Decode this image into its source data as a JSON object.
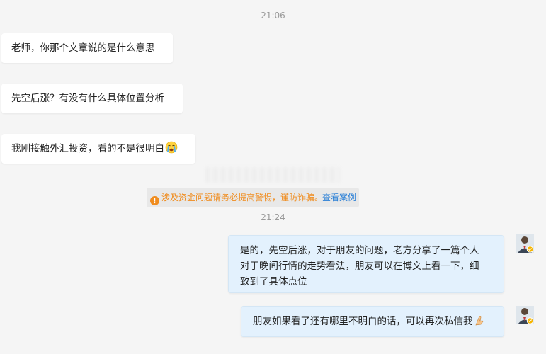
{
  "chat": {
    "time_1": "21:06",
    "time_2": "21:24",
    "incoming": [
      "老师，你那个文章说的是什么意思",
      "先空后涨？有没有什么具体位置分析",
      "我刚接触外汇投资，看的不是很明白"
    ],
    "outgoing": [
      {
        "lines": [
          "是的，先空后涨，对于朋友的问题，老方分享了一篇个人",
          "对于晚间行情的走势看法，朋友可以在博文上看一下，细",
          "致到了具体点位"
        ]
      },
      {
        "lines": [
          "朋友如果看了还有哪里不明白的话，可以再次私信我"
        ]
      }
    ],
    "emojis": [
      "crying-face-emoji",
      "folded-hands-emoji"
    ]
  },
  "warning": {
    "text": "涉及资金问题请务必提高警惕，谨防诈骗。",
    "link": "查看案例",
    "icon": "info-icon",
    "text_color": "#f08c1e",
    "link_color": "#2a7fd6"
  },
  "colors": {
    "background": "#f5f5f5",
    "incoming_bubble": "#ffffff",
    "outgoing_bubble": "#e3f1fd",
    "verified_badge": "#f5b400"
  }
}
